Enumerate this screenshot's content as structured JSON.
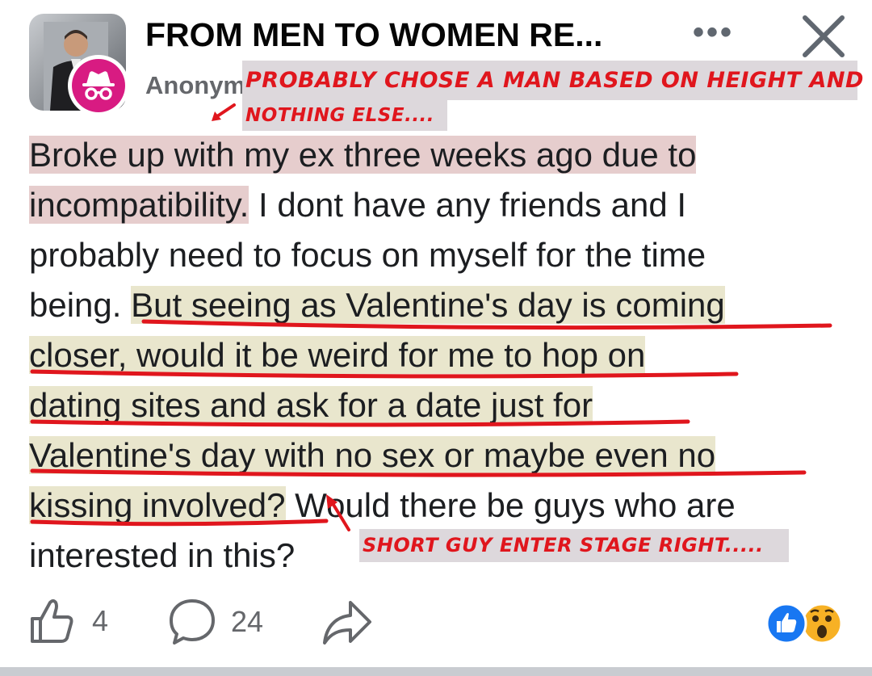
{
  "header": {
    "group_title": "FROM MEN TO WOMEN RE...",
    "author": "Anonym",
    "more_label": "•••",
    "close_label": "Close"
  },
  "annotations": {
    "note1": "PROBABLY CHOSE A MAN BASED ON HEIGHT AND",
    "note2": "NOTHING ELSE....",
    "note3": "SHORT GUY ENTER STAGE RIGHT....."
  },
  "post": {
    "l1": "Broke up with my ex three weeks ago due to ",
    "l2a": "incompatibility.",
    "l2b": " I dont have any friends and I",
    "l3": "probably need to focus on myself for the time",
    "l4a": "being. ",
    "l4b": "But seeing as Valentine's day is coming ",
    "l5": "closer, would it be weird for me to hop on",
    "l6": "dating sites and ask for a date just for ",
    "l7": "Valentine's day with no sex or maybe even no",
    "l8a": "kissing involved?",
    "l8b": " Would there be guys who are",
    "l9": "interested in this?"
  },
  "footer": {
    "like_count": "4",
    "comment_count": "24"
  },
  "colors": {
    "annotation_red": "#e0161d",
    "highlight_red": "#e6cdcd",
    "highlight_yellow": "#e9e6cd",
    "anon_badge": "#d81b82",
    "like_blue": "#1877f2"
  }
}
